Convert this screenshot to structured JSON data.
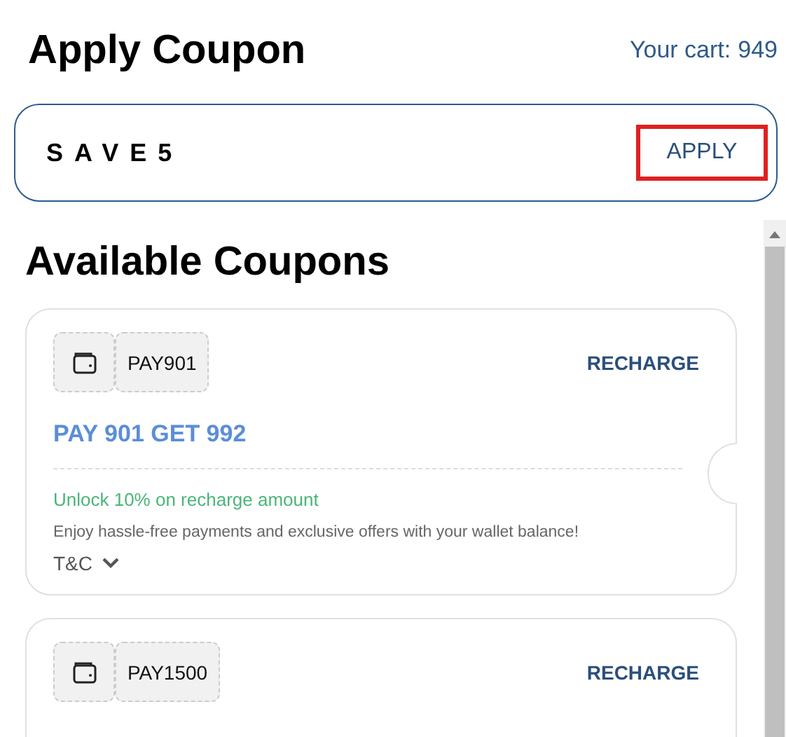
{
  "header": {
    "title": "Apply Coupon",
    "cart_label": "Your cart:",
    "cart_value": "949"
  },
  "coupon_input": {
    "value": "SAVE5",
    "button": "APPLY",
    "highlighted": true
  },
  "section_title": "Available Coupons",
  "coupons": [
    {
      "code": "PAY901",
      "action": "RECHARGE",
      "title": "PAY 901 GET 992",
      "benefit": "Unlock 10% on recharge amount",
      "description": "Enjoy hassle-free payments and exclusive offers with your wallet balance!",
      "terms": "T&C",
      "expanded": false
    },
    {
      "code": "PAY1500",
      "action": "RECHARGE"
    }
  ]
}
